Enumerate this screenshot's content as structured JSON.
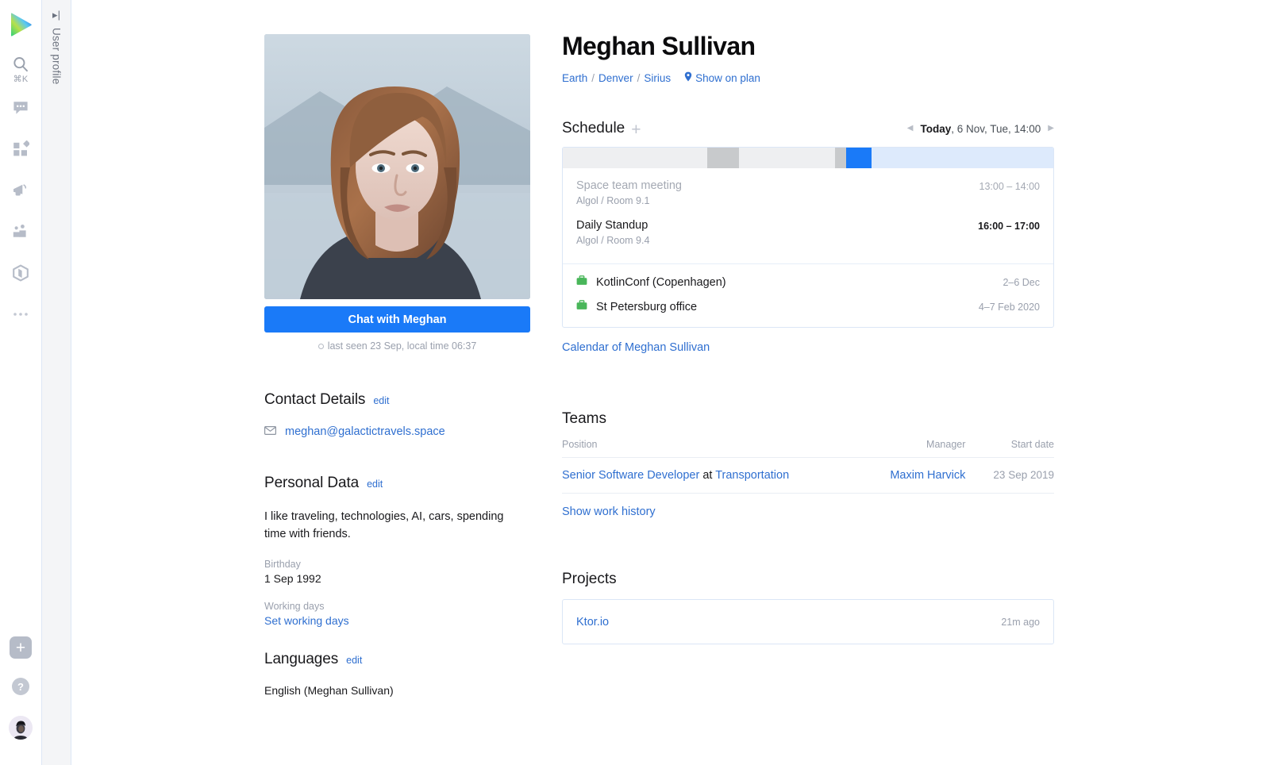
{
  "rail": {
    "logo_name": "app-logo",
    "search_shortcut": "⌘K",
    "items": [
      {
        "name": "search-icon",
        "label": "Search"
      },
      {
        "name": "chat-icon",
        "label": "Chats"
      },
      {
        "name": "apps-grid-icon",
        "label": "Apps"
      },
      {
        "name": "megaphone-icon",
        "label": "Announcements"
      },
      {
        "name": "people-icon",
        "label": "Teams"
      },
      {
        "name": "package-icon",
        "label": "Packages"
      },
      {
        "name": "more-icon",
        "label": "More"
      }
    ],
    "add_label": "+",
    "help_label": "?"
  },
  "vtab": {
    "label": "User profile",
    "icon": "collapse-panel-icon"
  },
  "profile": {
    "name": "Meghan Sullivan",
    "breadcrumb": [
      "Earth",
      "Denver",
      "Sirius"
    ],
    "breadcrumb_separator": "/",
    "show_on_plan": "Show on plan",
    "chat_button": "Chat with Meghan",
    "last_seen": "last seen 23 Sep, local time 06:37",
    "photo_alt": "portrait photo of Meghan Sullivan"
  },
  "contact": {
    "title": "Contact Details",
    "edit": "edit",
    "email": "meghan@galactictravels.space"
  },
  "personal": {
    "title": "Personal Data",
    "edit": "edit",
    "bio": "I like traveling, technologies, AI, cars, spending time with friends.",
    "birthday_label": "Birthday",
    "birthday_value": "1 Sep 1992",
    "working_days_label": "Working days",
    "working_days_link": "Set working days"
  },
  "languages": {
    "title": "Languages",
    "edit": "edit",
    "value": "English (Meghan Sullivan)"
  },
  "schedule": {
    "title": "Schedule",
    "add": "+",
    "prev_arrow": "◀",
    "next_arrow": "▶",
    "today_label": "Today",
    "date_label": ", 6 Nov, Tue, 14:00",
    "timeline": [
      {
        "name": "free",
        "color": "#eeeff1",
        "width": 29.5
      },
      {
        "name": "busy",
        "color": "#c8cacc",
        "width": 6.5
      },
      {
        "name": "free",
        "color": "#eeeff1",
        "width": 19.5
      },
      {
        "name": "busy",
        "color": "#c8cacc",
        "width": 2.2
      },
      {
        "name": "current",
        "color": "#1a7af8",
        "width": 5.3
      },
      {
        "name": "future",
        "color": "#ddeafc",
        "width": 37.0
      }
    ],
    "events": [
      {
        "name": "Space team meeting",
        "location": "Algol / Room 9.1",
        "time": "13:00 – 14:00",
        "state": "past"
      },
      {
        "name": "Daily Standup",
        "location": "Algol / Room 9.4",
        "time": "16:00 – 17:00",
        "state": "current"
      }
    ],
    "trips": [
      {
        "icon": "briefcase-icon",
        "name": "KotlinConf (Copenhagen)",
        "date": "2–6 Dec"
      },
      {
        "icon": "briefcase-icon",
        "name": "St Petersburg office",
        "date": "4–7 Feb 2020"
      }
    ],
    "calendar_link": "Calendar of Meghan Sullivan"
  },
  "teams": {
    "title": "Teams",
    "columns": [
      "Position",
      "Manager",
      "Start date"
    ],
    "rows": [
      {
        "position_link": "Senior Software Developer",
        "position_at": " at",
        "position_org": "Transportation",
        "manager": "Maxim Harvick",
        "start_date": "23 Sep 2019"
      }
    ],
    "work_history_link": "Show work history"
  },
  "projects": {
    "title": "Projects",
    "items": [
      {
        "name": "Ktor.io",
        "time": "21m ago"
      }
    ]
  },
  "colors": {
    "accent": "#1a7af8",
    "link": "#2f6fd0",
    "muted": "#9aa0ad",
    "green": "#49b65a",
    "card_border": "#dbe6f6"
  }
}
